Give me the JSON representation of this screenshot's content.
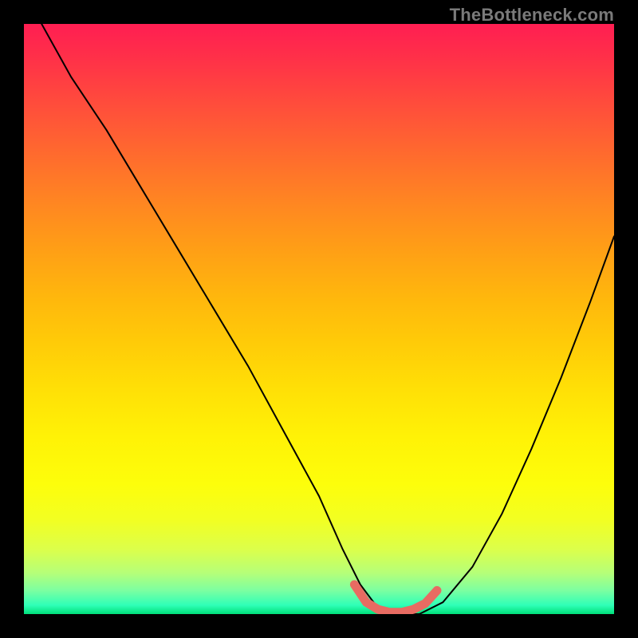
{
  "watermark": "TheBottleneck.com",
  "chart_data": {
    "type": "line",
    "title": "",
    "xlabel": "",
    "ylabel": "",
    "xlim": [
      0,
      100
    ],
    "ylim": [
      0,
      100
    ],
    "grid": false,
    "legend": false,
    "series": [
      {
        "name": "bottleneck-curve",
        "color": "#000000",
        "x": [
          3,
          8,
          14,
          20,
          26,
          32,
          38,
          44,
          50,
          54,
          57,
          60,
          63,
          67,
          71,
          76,
          81,
          86,
          91,
          96,
          100
        ],
        "y": [
          100,
          91,
          82,
          72,
          62,
          52,
          42,
          31,
          20,
          11,
          5,
          1,
          0,
          0,
          2,
          8,
          17,
          28,
          40,
          53,
          64
        ]
      },
      {
        "name": "optimum-band",
        "color": "#e86b62",
        "style": "thick",
        "x": [
          56,
          58,
          60,
          62,
          64,
          66,
          68,
          70
        ],
        "y": [
          5,
          2,
          0.8,
          0.3,
          0.3,
          0.8,
          1.8,
          4
        ]
      }
    ],
    "background_gradient": {
      "orientation": "vertical",
      "stops": [
        {
          "pos": 0.0,
          "color": "#ff1e52"
        },
        {
          "pos": 0.3,
          "color": "#ff8522"
        },
        {
          "pos": 0.6,
          "color": "#ffe006"
        },
        {
          "pos": 0.85,
          "color": "#e6ff3a"
        },
        {
          "pos": 0.97,
          "color": "#5cffac"
        },
        {
          "pos": 1.0,
          "color": "#00e07a"
        }
      ]
    }
  }
}
